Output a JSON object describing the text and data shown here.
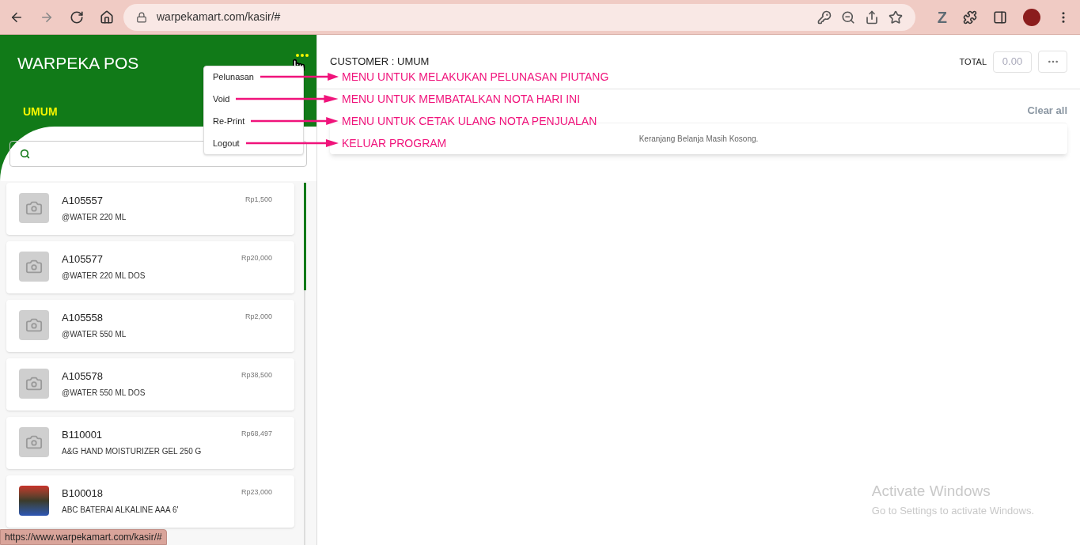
{
  "browser": {
    "url": "warpekamart.com/kasir/#",
    "extension_label": "Z",
    "status_url": "https://www.warpekamart.com/kasir/#"
  },
  "sidebar": {
    "title": "WARPEKA POS",
    "customer": "UMUM"
  },
  "products": [
    {
      "code": "A105557",
      "name": "@WATER 220 ML",
      "price": "Rp1,500",
      "kind": "none"
    },
    {
      "code": "A105577",
      "name": "@WATER 220 ML DOS",
      "price": "Rp20,000",
      "kind": "none"
    },
    {
      "code": "A105558",
      "name": "@WATER 550 ML",
      "price": "Rp2,000",
      "kind": "none"
    },
    {
      "code": "A105578",
      "name": "@WATER 550 ML DOS",
      "price": "Rp38,500",
      "kind": "none"
    },
    {
      "code": "B110001",
      "name": "A&G HAND MOISTURIZER GEL 250 G",
      "price": "Rp68,497",
      "kind": "none"
    },
    {
      "code": "B100018",
      "name": "ABC BATERAI ALKALINE AAA 6'",
      "price": "Rp23,000",
      "kind": "photo"
    }
  ],
  "cart": {
    "customer_label": "CUSTOMER : UMUM",
    "total_label": "TOTAL",
    "total_value": "0.00",
    "clear_all": "Clear all",
    "empty_message": "Keranjang Belanja Masih Kosong."
  },
  "menu": {
    "items": [
      {
        "label": "Pelunasan",
        "annotation": "MENU UNTUK MELAKUKAN PELUNASAN PIUTANG"
      },
      {
        "label": "Void",
        "annotation": "MENU UNTUK MEMBATALKAN NOTA HARI INI"
      },
      {
        "label": "Re-Print",
        "annotation": "MENU UNTUK CETAK ULANG NOTA PENJUALAN"
      },
      {
        "label": "Logout",
        "annotation": "KELUAR PROGRAM"
      }
    ]
  },
  "os_notice": {
    "title": "Activate Windows",
    "text": "Go to Settings to activate Windows."
  }
}
